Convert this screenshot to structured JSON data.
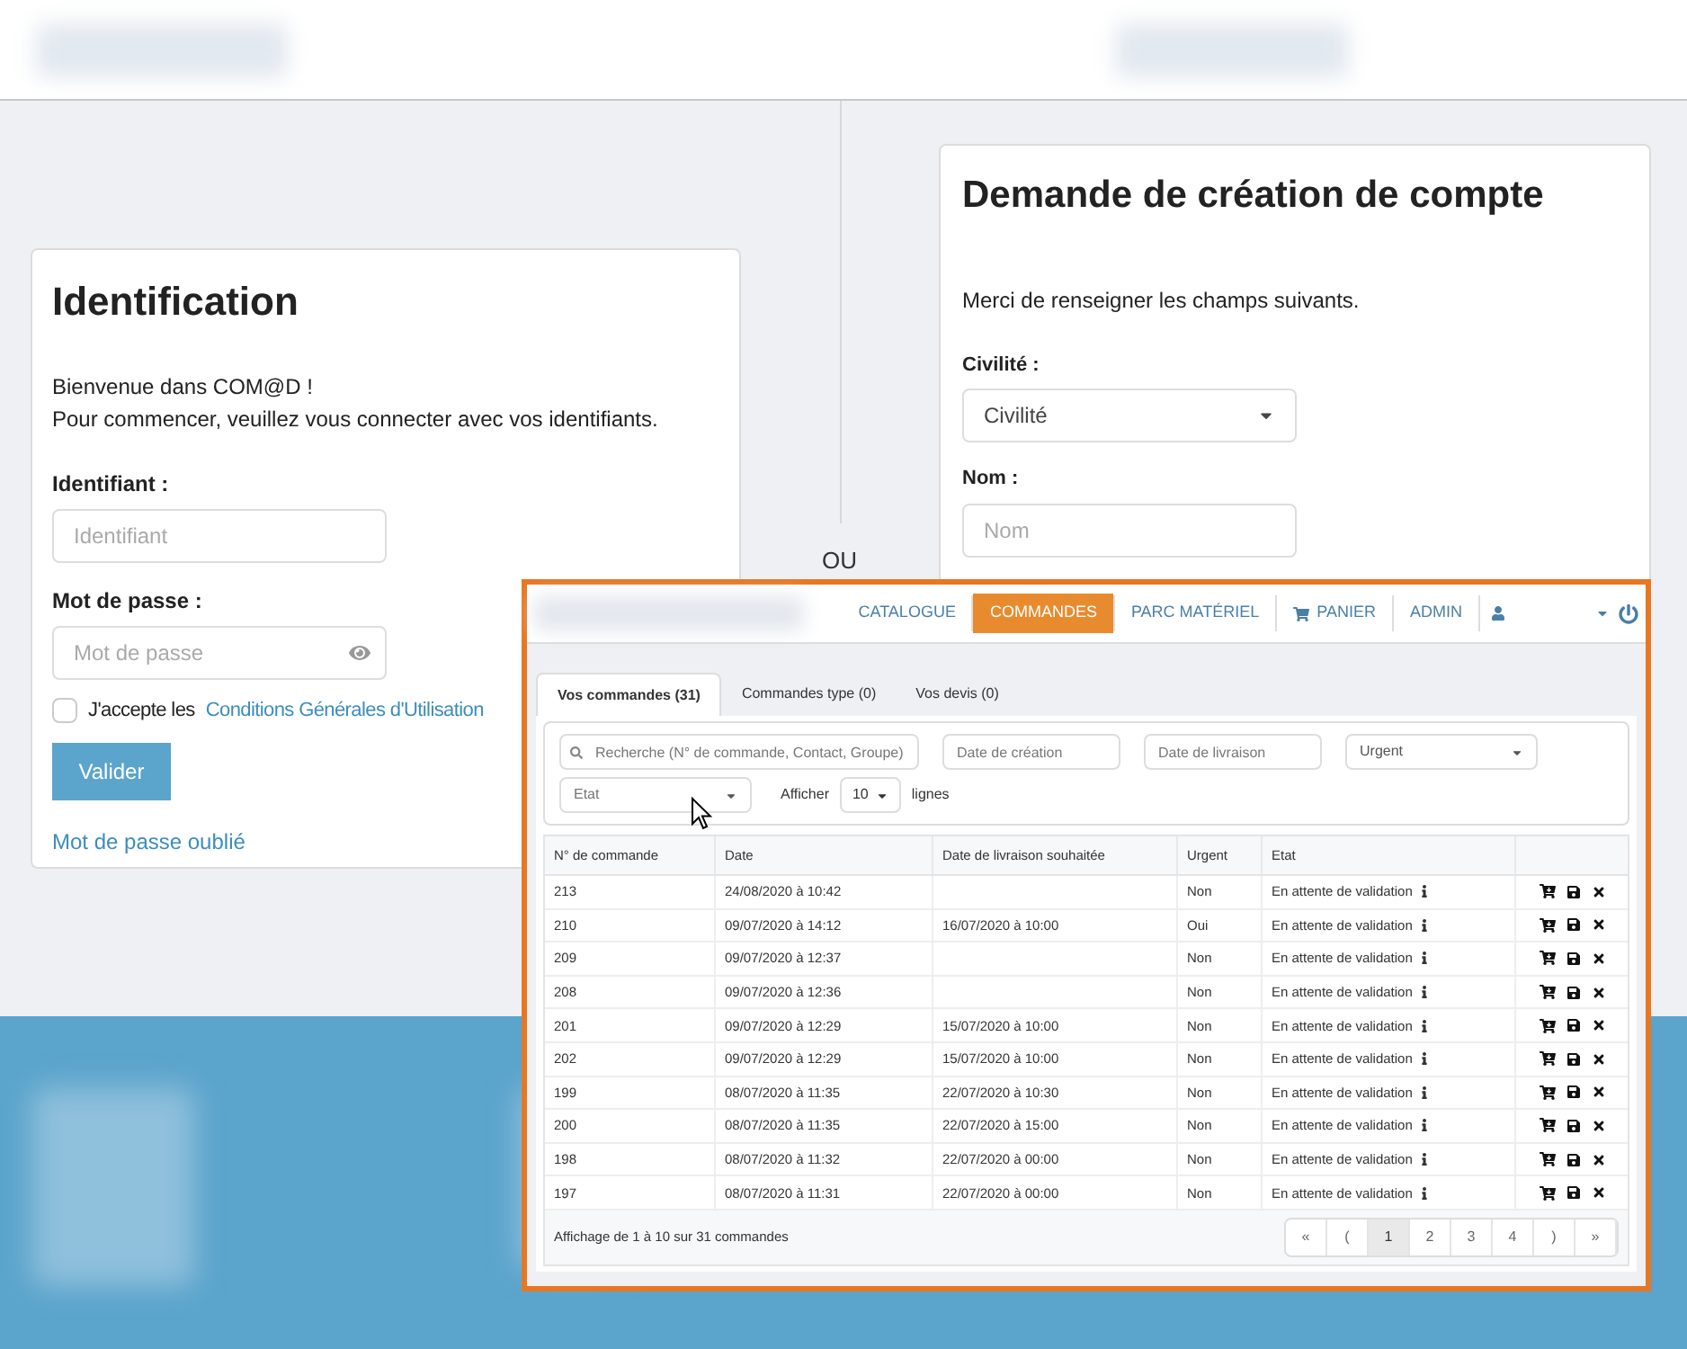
{
  "login": {
    "title": "Identification",
    "welcome": "Bienvenue dans COM@D !",
    "intro": "Pour commencer, veuillez vous connecter avec vos identifiants.",
    "id_label": "Identifiant :",
    "id_placeholder": "Identifiant",
    "password_label": "Mot de passe :",
    "password_placeholder": "Mot de passe",
    "terms_checked": false,
    "terms_text": "J'accepte les",
    "terms_link": "Conditions Générales d'Utilisation",
    "submit": "Valider",
    "forgot": "Mot de passe oublié"
  },
  "separator": "OU",
  "signup": {
    "title": "Demande de création de compte",
    "intro": "Merci de renseigner les champs suivants.",
    "civility_label": "Civilité :",
    "civility_value": "Civilité",
    "name_label": "Nom :",
    "name_placeholder": "Nom"
  },
  "orders_window": {
    "nav": [
      {
        "label": "CATALOGUE",
        "selected": false,
        "kind": "text"
      },
      {
        "label": "COMMANDES",
        "selected": true,
        "kind": "text"
      },
      {
        "label": "PARC MATÉRIEL",
        "selected": false,
        "kind": "text"
      },
      {
        "label": "PANIER",
        "selected": false,
        "kind": "cart"
      },
      {
        "label": "ADMIN",
        "selected": false,
        "kind": "text"
      }
    ],
    "tabs": [
      {
        "label": "Vos commandes (31)",
        "selected": true
      },
      {
        "label": "Commandes type (0)",
        "selected": false
      },
      {
        "label": "Vos devis (0)",
        "selected": false
      }
    ],
    "search_placeholder": "Recherche (N° de commande, Contact, Groupe)",
    "created_placeholder": "Date de création",
    "delivery_placeholder": "Date de livraison",
    "urgent_select": "Urgent",
    "state_select": "Etat",
    "show_label": "Afficher",
    "page_size": "10",
    "rows_label": "lignes",
    "table": {
      "columns": [
        "N° de commande",
        "Date",
        "Date de livraison souhaitée",
        "Urgent",
        "Etat"
      ],
      "rows": [
        [
          "213",
          "24/08/2020 à 10:42",
          "",
          "Non",
          "En attente de validation"
        ],
        [
          "210",
          "09/07/2020 à 14:12",
          "16/07/2020 à 10:00",
          "Oui",
          "En attente de validation"
        ],
        [
          "209",
          "09/07/2020 à 12:37",
          "",
          "Non",
          "En attente de validation"
        ],
        [
          "208",
          "09/07/2020 à 12:36",
          "",
          "Non",
          "En attente de validation"
        ],
        [
          "201",
          "09/07/2020 à 12:29",
          "15/07/2020 à 10:00",
          "Non",
          "En attente de validation"
        ],
        [
          "202",
          "09/07/2020 à 12:29",
          "15/07/2020 à 10:00",
          "Non",
          "En attente de validation"
        ],
        [
          "199",
          "08/07/2020 à 11:35",
          "22/07/2020 à 10:30",
          "Non",
          "En attente de validation"
        ],
        [
          "200",
          "08/07/2020 à 11:35",
          "22/07/2020 à 15:00",
          "Non",
          "En attente de validation"
        ],
        [
          "198",
          "08/07/2020 à 11:32",
          "22/07/2020 à 00:00",
          "Non",
          "En attente de validation"
        ],
        [
          "197",
          "08/07/2020 à 11:31",
          "22/07/2020 à 00:00",
          "Non",
          "En attente de validation"
        ]
      ]
    },
    "summary": "Affichage de 1 à 10 sur 31 commandes",
    "pagination": [
      {
        "label": "«",
        "selected": false
      },
      {
        "label": "(",
        "selected": false
      },
      {
        "label": "1",
        "selected": true
      },
      {
        "label": "2",
        "selected": false
      },
      {
        "label": "3",
        "selected": false
      },
      {
        "label": "4",
        "selected": false
      },
      {
        "label": ")",
        "selected": false
      },
      {
        "label": "»",
        "selected": false
      }
    ]
  }
}
